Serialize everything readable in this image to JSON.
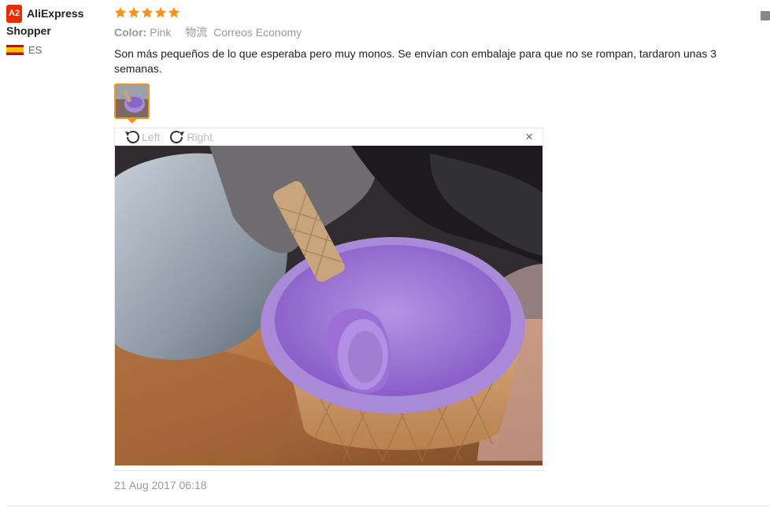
{
  "user": {
    "badge": "A2",
    "name": "AliExpress Shopper",
    "country": "ES"
  },
  "review": {
    "rating": 5,
    "color_label": "Color:",
    "color_value": "Pink",
    "shipping_label": "物流",
    "shipping_value": "Correos Economy",
    "text": "Son más pequeños de lo que esperaba pero muy monos. Se envían con embalaje para que no se rompan, tardaron unas 3 semanas.",
    "date": "21 Aug 2017 06:18"
  },
  "viewer": {
    "rotate_left": "Left",
    "rotate_right": "Right",
    "close": "×"
  },
  "colors": {
    "star": "#f7941d",
    "badge": "#e62e04",
    "thumb_border": "#f7941d",
    "bowl": "#a07fd0"
  }
}
